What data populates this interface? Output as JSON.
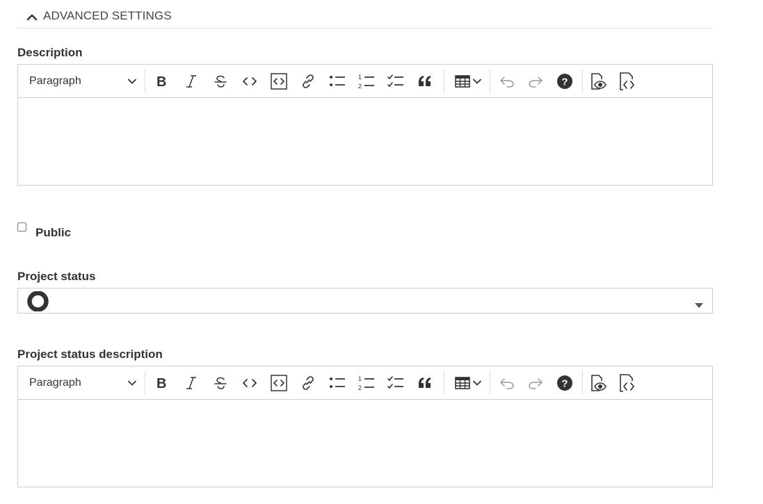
{
  "section": {
    "title": "ADVANCED SETTINGS",
    "icon": "chevron-up-icon"
  },
  "description": {
    "label": "Description",
    "editor": {
      "block_format": "Paragraph",
      "content": ""
    }
  },
  "toolbar_buttons": [
    "bold",
    "italic",
    "strikethrough",
    "code",
    "code-block",
    "link",
    "bulleted-list",
    "numbered-list",
    "to-do-list",
    "block-quote",
    "insert-table",
    "undo",
    "redo",
    "help",
    "preview",
    "source"
  ],
  "public": {
    "label": "Public",
    "checked": false
  },
  "project_status": {
    "label": "Project status",
    "selected_icon": "status-circle-icon",
    "selected_text": ""
  },
  "project_status_description": {
    "label": "Project status description",
    "editor": {
      "block_format": "Paragraph",
      "content": ""
    }
  },
  "colors": {
    "border": "#cccccc",
    "icon_dark": "#333333",
    "icon_disabled": "#999999"
  }
}
